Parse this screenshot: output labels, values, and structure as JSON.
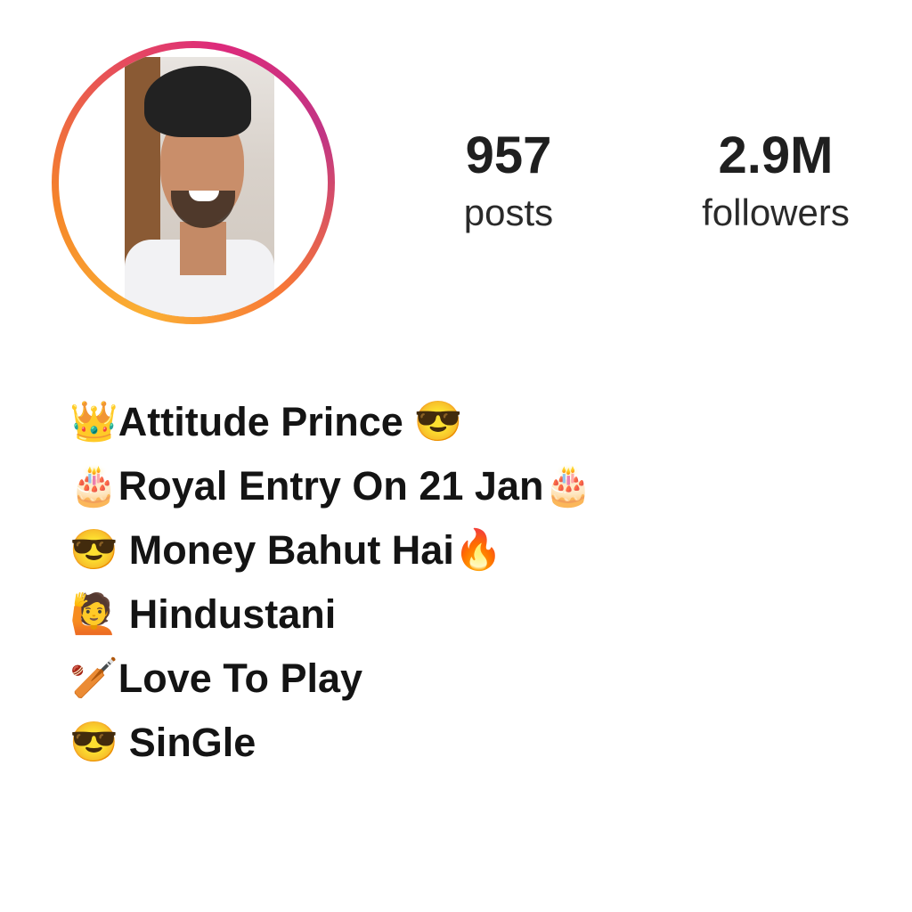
{
  "profile": {
    "stats": {
      "posts": {
        "value": "957",
        "label": "posts"
      },
      "followers": {
        "value": "2.9M",
        "label": "followers"
      }
    },
    "bio": [
      {
        "lead": "👑",
        "text": "Attitude Prince",
        "trail": "😎"
      },
      {
        "lead": "🎂",
        "text": "Royal Entry On 21 Jan",
        "trail": "🎂"
      },
      {
        "lead": "😎",
        "text": "Money Bahut Hai",
        "trail": "🔥"
      },
      {
        "lead": "🙋",
        "text": "Hindustani",
        "trail": ""
      },
      {
        "lead": "🏏",
        "text": "Love To Play",
        "trail": ""
      },
      {
        "lead": "😎",
        "text": "SinGle",
        "trail": ""
      }
    ]
  },
  "colors": {
    "ring_gradient": [
      "#fbb034",
      "#f58529",
      "#dd2a7b",
      "#c13584"
    ],
    "text": "#141414",
    "background": "#ffffff"
  },
  "icons": {
    "avatar": "profile-photo",
    "bio_emojis": [
      "crown-icon",
      "sunglasses-face-icon",
      "birthday-cake-icon",
      "fire-icon",
      "person-raising-hand-icon",
      "cricket-bat-icon"
    ]
  }
}
